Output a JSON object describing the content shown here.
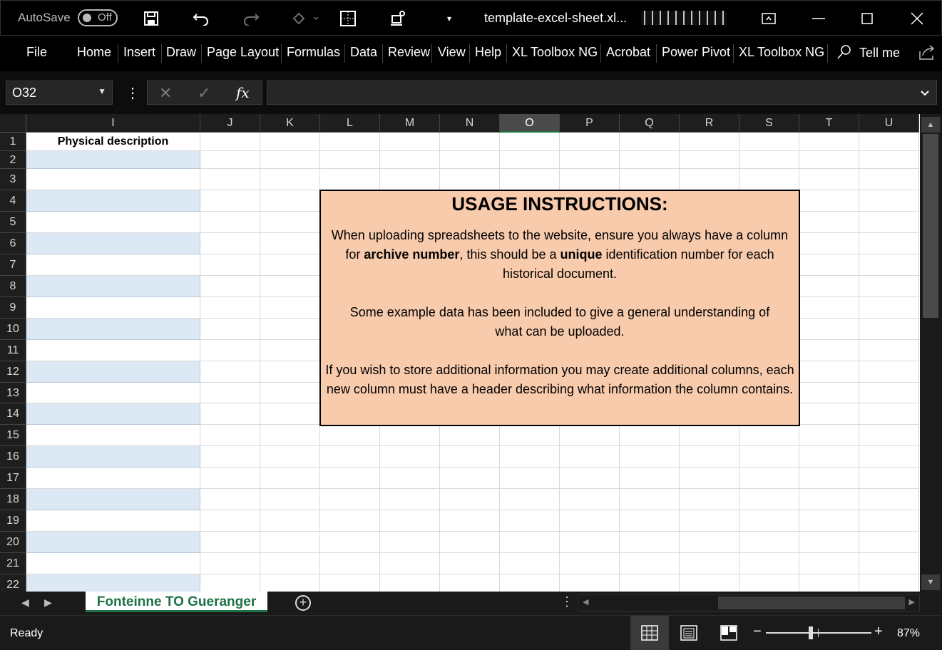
{
  "titlebar": {
    "autosave_label": "AutoSave",
    "autosave_state": "Off",
    "doc_title": "template-excel-sheet.xl...",
    "icons": [
      "save-icon",
      "undo-icon",
      "redo-icon",
      "paint-bucket-icon",
      "borders-icon",
      "robot-icon",
      "customize-dropdown-icon"
    ]
  },
  "ribbon": {
    "tabs": [
      "File",
      "Home",
      "Insert",
      "Draw",
      "Page Layout",
      "Formulas",
      "Data",
      "Review",
      "View",
      "Help",
      "XL Toolbox NG",
      "Acrobat",
      "Power Pivot",
      "XL Toolbox NG"
    ],
    "tell_me": "Tell me"
  },
  "formula_bar": {
    "name_box": "O32",
    "fx_label": "fx",
    "value": ""
  },
  "sheet": {
    "columns": [
      "I",
      "J",
      "K",
      "L",
      "M",
      "N",
      "O",
      "P",
      "Q",
      "R",
      "S",
      "T",
      "U"
    ],
    "selected_column": "O",
    "rows": [
      "1",
      "2",
      "3",
      "4",
      "5",
      "6",
      "7",
      "8",
      "9",
      "10",
      "11",
      "12",
      "13",
      "14",
      "15",
      "16",
      "17",
      "18",
      "19",
      "20",
      "21",
      "22"
    ],
    "header_I1": "Physical description",
    "band_color": "#dce8f4"
  },
  "textbox": {
    "title": "USAGE INSTRUCTIONS:",
    "p1_before": "When uploading spreadsheets to the website, ensure you always have a column for ",
    "p1_bold1": "archive number",
    "p1_mid": ", this should be a ",
    "p1_bold2": "unique",
    "p1_after": " identification number for each historical document.",
    "p2": "Some example data has been included to give a general understanding of what can be uploaded.",
    "p3": "If you wish to store additional information you may create additional columns, each new column must have a header describing what information the column contains.",
    "fill_color": "#f8cbad"
  },
  "sheet_tabs": {
    "active": "Fonteinne TO Gueranger"
  },
  "status": {
    "ready": "Ready",
    "zoom": "87%"
  }
}
